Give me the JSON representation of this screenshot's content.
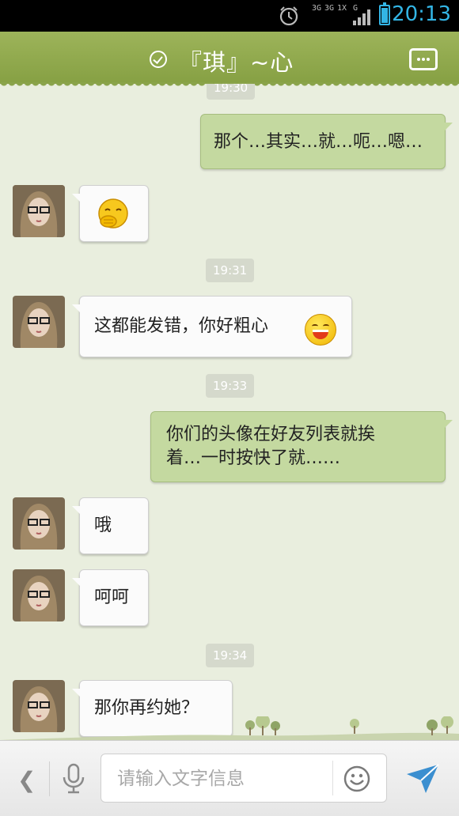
{
  "status_bar": {
    "time": "20:13",
    "network_labels": [
      "3G",
      "3G",
      "1X",
      "G"
    ],
    "battery_level": 0.85
  },
  "header": {
    "title": "『琪』~心"
  },
  "messages": [
    {
      "type": "timestamp",
      "text": "19:30"
    },
    {
      "type": "out",
      "text": "那个…其实…就…呃…嗯…"
    },
    {
      "type": "in",
      "emoji": "shy-smile-emoji"
    },
    {
      "type": "timestamp",
      "text": "19:31"
    },
    {
      "type": "in",
      "text": "这都能发错，你好粗心",
      "emoji": "grin-emoji"
    },
    {
      "type": "timestamp",
      "text": "19:33"
    },
    {
      "type": "out",
      "text": [
        "你们的头像在好友列表就挨",
        "着…一时按快了就……"
      ]
    },
    {
      "type": "in",
      "text": "哦"
    },
    {
      "type": "in",
      "text": "呵呵"
    },
    {
      "type": "timestamp",
      "text": "19:34"
    },
    {
      "type": "in",
      "text": "那你再约她？"
    }
  ],
  "input_bar": {
    "placeholder": "请输入文字信息",
    "icons": [
      "chevron-left-icon",
      "microphone-icon",
      "smiley-icon",
      "send-icon"
    ]
  },
  "colors": {
    "header_green": "#8aa34a",
    "outgoing_bubble": "#c4d9a0",
    "status_blue": "#33b5e5"
  }
}
